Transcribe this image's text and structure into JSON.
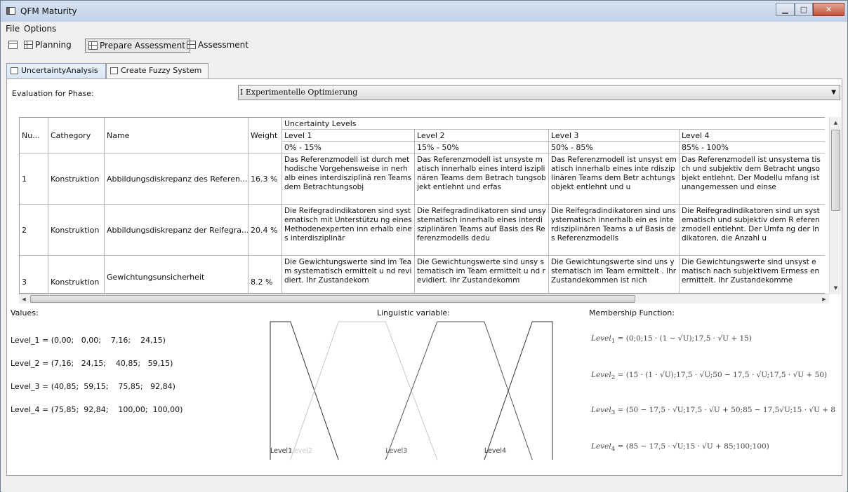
{
  "window": {
    "title": "QFM Maturity",
    "min_label": "▁",
    "max_label": "□",
    "close_label": "✕"
  },
  "menu": {
    "items": [
      "File",
      "Options"
    ]
  },
  "toolbar": {
    "planning": "Planning",
    "prepare": "Prepare Assessment",
    "assessment": "Assessment"
  },
  "tabs": {
    "uncertainty": "UncertaintyAnalysis",
    "fuzzy": "Create Fuzzy System"
  },
  "evaluation": {
    "label": "Evaluation for Phase:",
    "selected": "I Experimentelle Optimierung"
  },
  "grid": {
    "headers": {
      "num": "Nu...",
      "category": "Cathegory",
      "name": "Name",
      "weight": "Weight",
      "group": "Uncertainty Levels"
    },
    "levels": [
      {
        "name": "Level 1",
        "range": "0% - 15%"
      },
      {
        "name": "Level 2",
        "range": "15% - 50%"
      },
      {
        "name": "Level 3",
        "range": "50% - 85%"
      },
      {
        "name": "Level 4",
        "range": "85% - 100%"
      }
    ],
    "rows": [
      {
        "num": "1",
        "category": "Konstruktion",
        "name": "Abbildungsdiskrepanz des Referen...",
        "weight": "16.3 %",
        "levels": [
          "Das Referenzmodell ist durch methodische Vorgehensweise in nerhalb eines interdisziplinä ren Teams dem Betrachtungsobj",
          "Das Referenzmodell ist unsyste matisch innerhalb eines interd isziplinären Teams dem Betrach tungsobjekt entlehnt und erfas",
          "Das Referenzmodell ist unsyst ematisch innerhalb eines inte rdisziplinären Teams dem Betr achtungsobjekt entlehnt und u",
          "Das Referenzmodell ist unsystema tisch und subjektiv dem Betracht ungsobjekt entlehnt. Der Modellu mfang ist unangemessen und einse"
        ]
      },
      {
        "num": "2",
        "category": "Konstruktion",
        "name": "Abbildungsdiskrepanz der Reifegra...",
        "weight": "20.4 %",
        "levels": [
          "Die Reifegradindikatoren sind systematisch mit Unterstützu ng eines Methodenexperten inn erhalb eines interdisziplinär",
          "Die Reifegradindikatoren sind unsystematisch innerhalb eines interdisziplinären Teams auf Basis des Referenzmodells dedu",
          "Die Reifegradindikatoren sind unsystematisch innerhalb ein es interdisziplinären Teams a uf Basis des Referenzmodells",
          "Die Reifegradindikatoren sind un systematisch und subjektiv dem R eferenzmodell entlehnt. Der Umfa ng der Indikatoren, die Anzahl u"
        ]
      },
      {
        "num": "3",
        "category": "Konstruktion",
        "name": "Gewichtungsunsicherheit",
        "weight": "8.2 %",
        "levels": [
          "Die Gewichtungswerte sind im Team systematisch ermittelt u nd revidiert. Ihr Zustandekom",
          "Die Gewichtungswerte sind unsy stematisch im Team ermittelt u nd revidiert. Ihr Zustandekomm",
          "Die Gewichtungswerte sind uns ystematisch im Team ermittelt . Ihr Zustandekommen ist nich",
          "Die Gewichtungswerte sind unsyst ematisch nach subjektivem Ermess en ermittelt. Ihr Zustandekomme"
        ]
      }
    ]
  },
  "values": {
    "label": "Values:",
    "lines": [
      "Level_1 = (0,00;   0,00;    7,16;    24,15)",
      "Level_2 = (7,16;   24,15;    40,85;   59,15)",
      "Level_3 = (40,85;  59,15;    75,85;   92,84)",
      "Level_4 = (75,85;  92,84;    100,00;  100,00)"
    ]
  },
  "linguistic": {
    "label": "Linguistic variable:",
    "sets": [
      {
        "name": "Level1",
        "points": [
          0,
          0,
          7.16,
          24.15
        ],
        "color": "#333333"
      },
      {
        "name": "Level2",
        "points": [
          7.16,
          24.15,
          40.85,
          59.15
        ],
        "color": "#c8c8c8"
      },
      {
        "name": "Level3",
        "points": [
          40.85,
          59.15,
          75.85,
          92.84
        ],
        "color": "#555555"
      },
      {
        "name": "Level4",
        "points": [
          75.85,
          92.84,
          100,
          100
        ],
        "color": "#333333"
      }
    ]
  },
  "membership": {
    "label": "Membership Function:",
    "formulas": [
      {
        "lhs": "Level",
        "sub": "1",
        "rhs": " = (0;0;15 · (1 − √U);17,5 · √U + 15)"
      },
      {
        "lhs": "Level",
        "sub": "2",
        "rhs": " = (15 · (1 · √U);17,5 · √U;50 − 17,5 · √U;17,5 · √U + 50)"
      },
      {
        "lhs": "Level",
        "sub": "3",
        "rhs": " = (50 − 17,5 · √U;17,5 · √U + 50;85 − 17,5√U;15 · √U + 8"
      },
      {
        "lhs": "Level",
        "sub": "4",
        "rhs": " = (85 − 17,5 · √U;15 · √U + 85;100;100)"
      }
    ]
  }
}
